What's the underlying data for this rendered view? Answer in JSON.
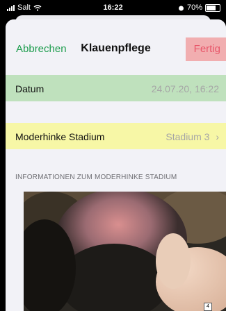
{
  "status": {
    "carrier": "Salt",
    "time": "16:22",
    "battery": "70%"
  },
  "nav": {
    "cancel": "Abbrechen",
    "title": "Klauenpflege",
    "done": "Fertig"
  },
  "date_row": {
    "label": "Datum",
    "value": "24.07.20, 16:22"
  },
  "stage_row": {
    "label": "Moderhinke Stadium",
    "value": "Stadium 3"
  },
  "info_header": "INFORMATIONEN ZUM MODERHINKE STADIUM",
  "photo": {
    "badge": "4"
  },
  "colors": {
    "accent_green": "#1e9d4e",
    "done_red": "#e8576a",
    "date_bg": "#bfe1bd",
    "stage_bg": "#f7f7a6"
  }
}
